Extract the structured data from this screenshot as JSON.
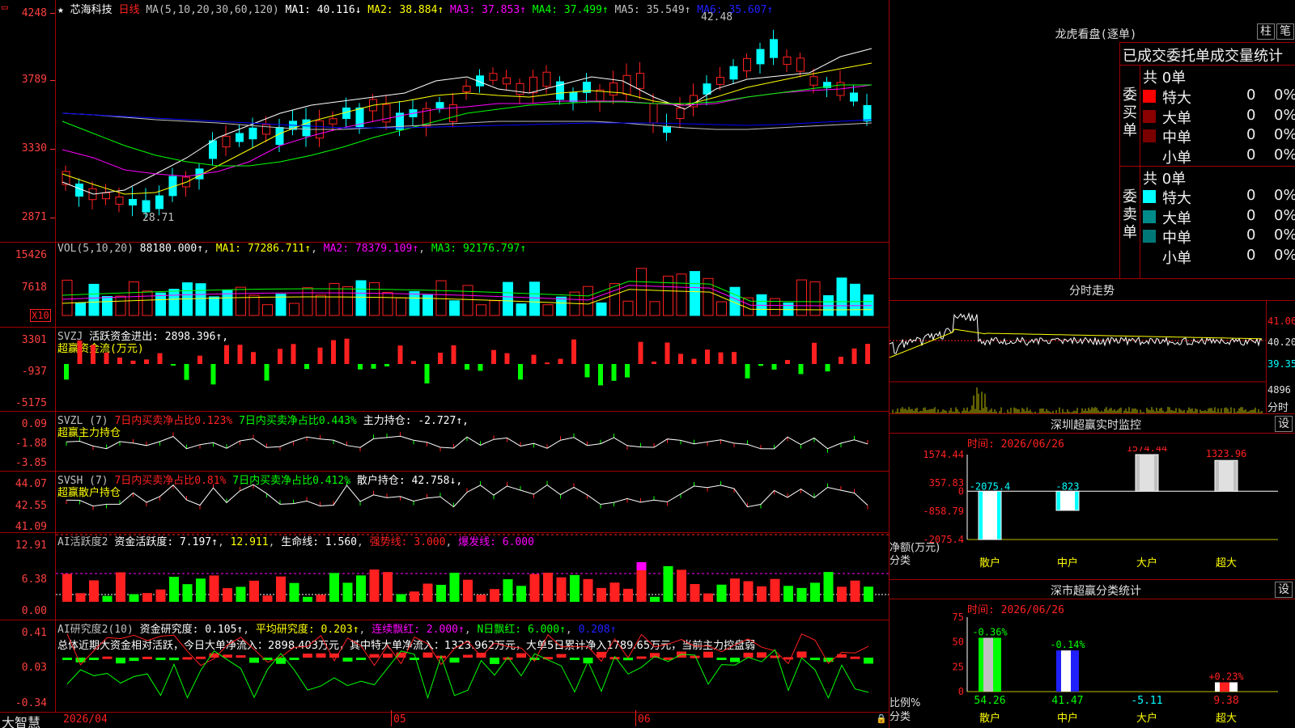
{
  "colors": {
    "up": "#ff2020",
    "down": "#00ffff",
    "ma1": "#ffffff",
    "ma2": "#ffff00",
    "ma3": "#ff00ff",
    "ma4": "#00ff00",
    "ma5": "#c0c0c0",
    "ma6": "#0000ff",
    "grid": "#a00000",
    "green_bar": "#00ff00",
    "magenta": "#ff00ff",
    "yellow": "#ffff00"
  },
  "main": {
    "star": "★",
    "stock_name": "芯海科技",
    "period": "日线",
    "ma_header": "MA(5,10,20,30,60,120)",
    "ma1": "MA1: 40.116↓",
    "ma2": "MA2: 38.884↑",
    "ma3": "MA3: 37.853↑",
    "ma4": "MA4: 37.499↑",
    "ma5": "MA5: 35.549↑",
    "ma6": "MA6: 35.607↑",
    "high_label": "42.48",
    "low_label": "28.71",
    "axis": [
      "4248",
      "3789",
      "3330",
      "2871"
    ]
  },
  "vol": {
    "header": "VOL(5,10,20)",
    "value": "88180.000↑",
    "ma1": "MA1: 77286.711↑",
    "ma2": "MA2: 78379.109↑",
    "ma3": "MA3: 92176.797↑",
    "axis": [
      "15426",
      "7618"
    ],
    "unit": "X10"
  },
  "svzj": {
    "header": "SVZJ",
    "value": "活跃资金进出: 2898.396↑,",
    "subtitle": "超赢资金流(万元)",
    "axis": [
      "3301",
      "-937",
      "-5175"
    ]
  },
  "svzl": {
    "header": "SVZL (7)",
    "a": "7日内买卖净占比0.123%",
    "b": "7日内买卖净占比0.443%",
    "c": "主力持仓: -2.727↑,",
    "subtitle": "超赢主力持仓",
    "axis": [
      "0.09",
      "-1.88",
      "-3.85"
    ]
  },
  "svsh": {
    "header": "SVSH (7)",
    "a": "7日内买卖净占比0.81%",
    "b": "7日内买卖净占比0.412%",
    "c": "散户持仓: 42.758↓,",
    "subtitle": "超赢散户持仓",
    "axis": [
      "44.07",
      "42.55",
      "41.09"
    ]
  },
  "ai_active": {
    "header": "AI活跃度2",
    "a": "资金活跃度: 7.197↑",
    "b": "12.911",
    "c": "生命线: 1.560",
    "d": "强势线: 3.000",
    "e": "爆发线: 6.000",
    "axis": [
      "12.91",
      "6.38",
      "0.00"
    ]
  },
  "ai_research": {
    "header": "AI研究度2(10)",
    "a": "资金研究度: 0.105↑",
    "b": "平均研究度: 0.203↑",
    "c": "连续飘红: 2.000↑",
    "d": "N日飘红: 6.000↑",
    "e": "0.208↑",
    "summary": "总体近期大资金相对活跃，今日大单净流入：2898.403万元，其中特大单净流入：1323.962万元，大单5日累计净入1789.65万元，当前主力控盘弱",
    "axis": [
      "0.41",
      "0.03",
      "-0.34"
    ]
  },
  "bottom": {
    "logo": "大智慧",
    "date1": "2026/04",
    "date2": "05",
    "date3": "06"
  },
  "dragon": {
    "title": "龙虎看盘(逐单)",
    "btn1": "柱",
    "btn2": "笔",
    "subtitle": "已成交委托单成交量统计",
    "buy_label": "委买单",
    "sell_label": "委卖单",
    "buy_total": "共 0单",
    "sell_total": "共 0单",
    "rows": [
      {
        "name": "特大",
        "count": "0",
        "pct": "0%"
      },
      {
        "name": "大单",
        "count": "0",
        "pct": "0%"
      },
      {
        "name": "中单",
        "count": "0",
        "pct": "0%"
      },
      {
        "name": "小单",
        "count": "0",
        "pct": "0%"
      }
    ],
    "buy_colors": [
      "#ff0000",
      "#8b0000",
      "#7a0000",
      ""
    ],
    "sell_colors": [
      "#00ffff",
      "#008b8b",
      "#007878",
      ""
    ]
  },
  "intraday": {
    "title": "分时走势",
    "axis": [
      "41.06",
      "40.20",
      "39.35",
      "4896"
    ],
    "unit": "分时"
  },
  "sz_monitor": {
    "title": "深圳超赢实时监控",
    "set": "设",
    "time": "时间: 2026/06/26",
    "axis": [
      "1574.44",
      "357.83",
      "0",
      "-858.79",
      "-2075.4"
    ],
    "ylabel": "净额(万元)",
    "xlabel": "分类",
    "categories": [
      "散户",
      "中户",
      "大户",
      "超大"
    ],
    "values": [
      "-2075.4",
      "-823",
      "1574.44",
      "1323.96"
    ]
  },
  "sz_class": {
    "title": "深市超赢分类统计",
    "set": "设",
    "time": "时间: 2026/06/26",
    "axis": [
      "75",
      "50",
      "25",
      "0"
    ],
    "ylabel": "比例%",
    "xlabel": "分类",
    "categories": [
      "散户",
      "中户",
      "大户",
      "超大"
    ],
    "values": [
      "54.26",
      "41.47",
      "-5.11",
      "9.38"
    ],
    "deltas": [
      "-0.36%",
      "-0.14%",
      "",
      "+0.23%"
    ]
  }
}
